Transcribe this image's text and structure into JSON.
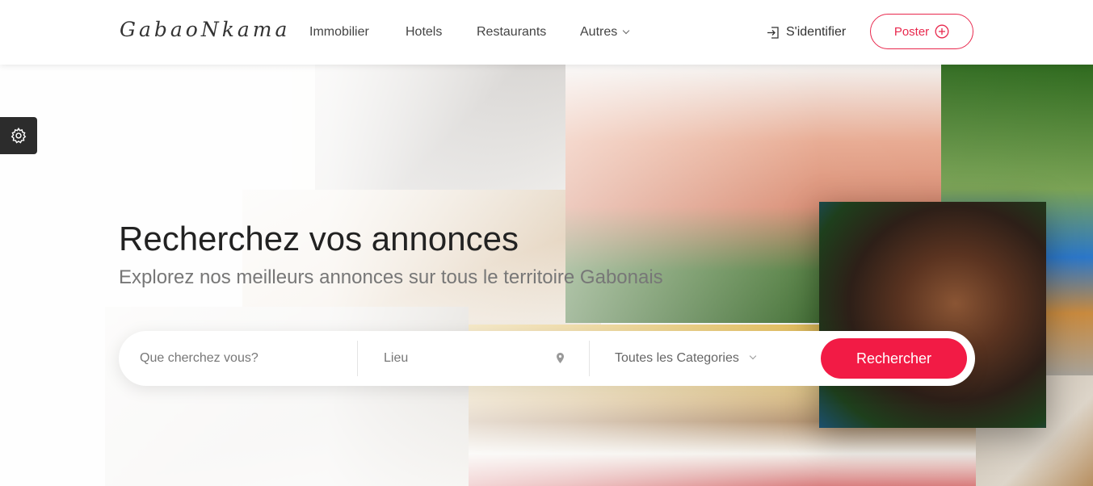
{
  "header": {
    "logo": "GabaoNkama",
    "nav": [
      {
        "label": "Immobilier"
      },
      {
        "label": "Hotels"
      },
      {
        "label": "Restaurants"
      },
      {
        "label": "Autres"
      }
    ],
    "login_label": "S'identifier",
    "post_label": "Poster"
  },
  "hero": {
    "title": "Recherchez vos annonces",
    "subtitle": "Explorez nos meilleurs annonces sur tous le territoire Gabonais"
  },
  "search": {
    "query_placeholder": "Que cherchez vous?",
    "location_placeholder": "Lieu",
    "category_selected": "Toutes les Categories",
    "button_label": "Rechercher"
  },
  "colors": {
    "accent": "#f21b45",
    "post_border": "#e8284d"
  }
}
